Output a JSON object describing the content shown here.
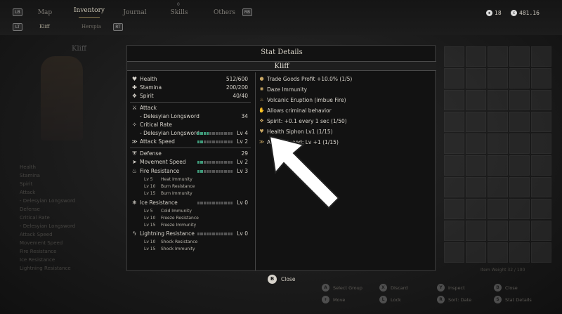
{
  "topbar": {
    "left_badge": "LB",
    "right_badge": "RB",
    "lt_badge": "LT",
    "rt_badge": "RT",
    "tabs": [
      {
        "label": "Map"
      },
      {
        "label": "Inventory"
      },
      {
        "label": "Journal"
      },
      {
        "label": "Skills"
      },
      {
        "label": "Others"
      }
    ],
    "subtabs": [
      {
        "label": "Kliff"
      },
      {
        "label": "Herspia"
      }
    ],
    "skills_badge": "0",
    "badge_count": "18",
    "currency": "481.16"
  },
  "modal": {
    "title": "Stat Details",
    "character": "Kliff",
    "left_stats": {
      "health": {
        "label": "Health",
        "value": "512/600",
        "icon": "heart-icon"
      },
      "stamina": {
        "label": "Stamina",
        "value": "200/200",
        "icon": "stamina-icon"
      },
      "spirit": {
        "label": "Spirit",
        "value": "40/40",
        "icon": "spirit-icon"
      },
      "attack": {
        "label": "Attack",
        "icon": "sword-icon"
      },
      "attack_weapon": {
        "label": "- Delesyian Longsword",
        "value": "34"
      },
      "crit": {
        "label": "Critical Rate",
        "icon": "crit-icon"
      },
      "crit_weapon": {
        "label": "- Delesyian Longsword",
        "value": "Lv 4",
        "fill": 0.3
      },
      "attack_speed": {
        "label": "Attack Speed",
        "value": "Lv 2",
        "fill": 0.15,
        "icon": "speed-icon"
      },
      "defense": {
        "label": "Defense",
        "value": "29",
        "icon": "shield-icon"
      },
      "move_speed": {
        "label": "Movement Speed",
        "value": "Lv 2",
        "fill": 0.15,
        "icon": "boot-icon"
      },
      "fire": {
        "label": "Fire Resistance",
        "value": "Lv 3",
        "fill": 0.2,
        "icon": "fire-icon"
      },
      "fire_subs": [
        {
          "lv": "Lv 5",
          "effect": "Heat Immunity"
        },
        {
          "lv": "Lv 10",
          "effect": "Burn Resistance"
        },
        {
          "lv": "Lv 15",
          "effect": "Burn Immunity"
        }
      ],
      "ice": {
        "label": "Ice Resistance",
        "value": "Lv 0",
        "fill": 0,
        "icon": "snowflake-icon"
      },
      "ice_subs": [
        {
          "lv": "Lv 5",
          "effect": "Cold Immunity"
        },
        {
          "lv": "Lv 10",
          "effect": "Freeze Resistance"
        },
        {
          "lv": "Lv 15",
          "effect": "Freeze Immunity"
        }
      ],
      "lightning": {
        "label": "Lightning Resistance",
        "value": "Lv 0",
        "fill": 0,
        "icon": "lightning-icon"
      },
      "lightning_subs": [
        {
          "lv": "Lv 10",
          "effect": "Shock Resistance"
        },
        {
          "lv": "Lv 15",
          "effect": "Shock Immunity"
        }
      ]
    },
    "right_effects": [
      {
        "icon": "coin-icon",
        "label": "Trade Goods Profit +10.0% (1/5)"
      },
      {
        "icon": "daze-icon",
        "label": "Daze Immunity"
      },
      {
        "icon": "fire-icon",
        "label": "Volcanic Eruption (imbue Fire)"
      },
      {
        "icon": "hand-icon",
        "label": "Allows criminal behavior"
      },
      {
        "icon": "spirit-icon",
        "label": "Spirit: +0.1 every 1 sec (1/50)"
      },
      {
        "icon": "heart-icon",
        "label": "Health Siphon Lv1 (1/15)"
      },
      {
        "icon": "speed-icon",
        "label": "Attack Speed: Lv +1 (1/15)"
      }
    ]
  },
  "close": {
    "button": "B",
    "label": "Close"
  },
  "background": {
    "char_name": "Kliff",
    "left_list": [
      "Health",
      "Stamina",
      "Spirit",
      "Attack",
      "- Delesyian Longsword",
      "Defense",
      "Critical Rate",
      "- Delesyian Longsword",
      "Attack Speed",
      "Movement Speed",
      "Fire Resistance",
      "Ice Resistance",
      "Lightning Resistance"
    ],
    "hints": [
      {
        "btn": "A",
        "label": "Select Group"
      },
      {
        "btn": "X",
        "label": "Discard"
      },
      {
        "btn": "Y",
        "label": "Inspect"
      },
      {
        "btn": "B",
        "label": "Close"
      },
      {
        "btn": "+",
        "label": "Move"
      },
      {
        "btn": "L",
        "label": "Lock"
      },
      {
        "btn": "R",
        "label": "Sort: Date"
      },
      {
        "btn": "S",
        "label": "Stat Details"
      }
    ],
    "weight_text": "Item Weight 32 / 100"
  }
}
